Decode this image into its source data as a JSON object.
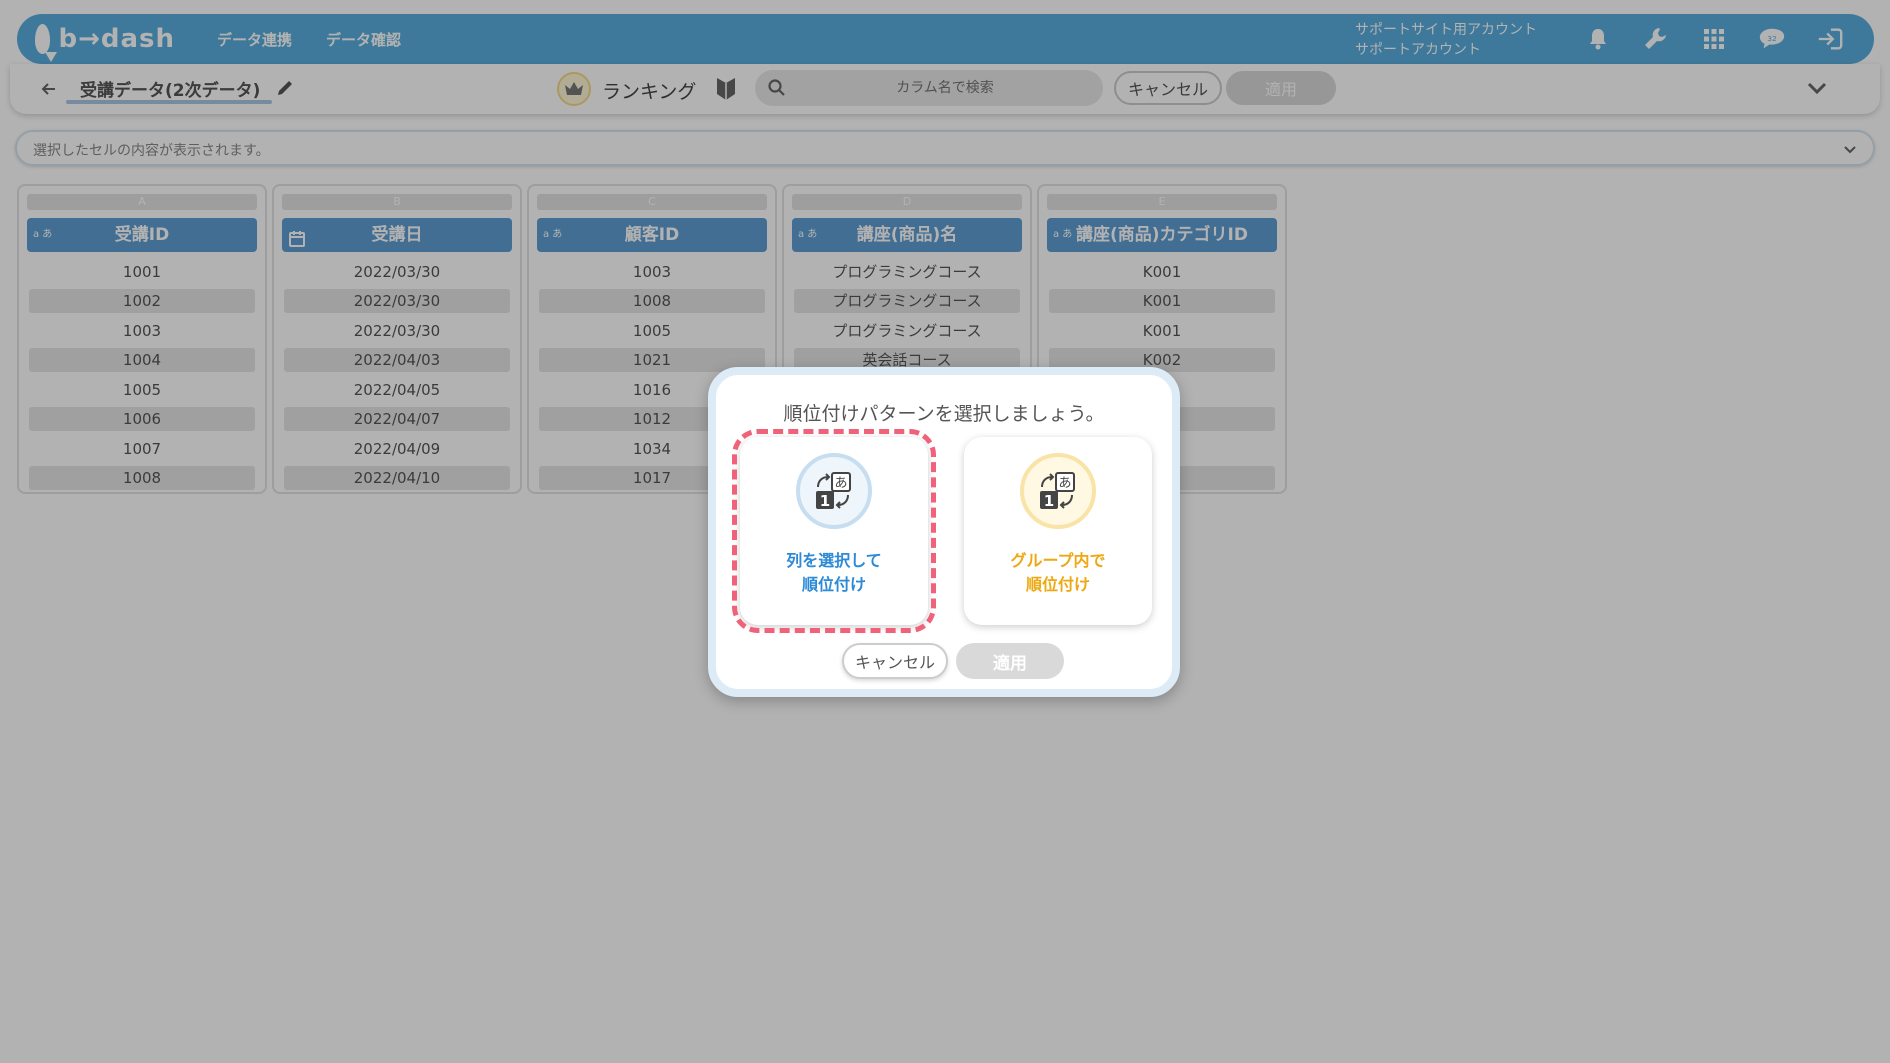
{
  "header": {
    "logo_text": "b→dash",
    "nav": [
      "データ連携",
      "データ確認"
    ],
    "account_line1": "サポートサイト用アカウント",
    "account_line2": "サポートアカウント",
    "icons": [
      "bell-icon",
      "wrench-icon",
      "grid-icon",
      "chat-icon",
      "logout-icon"
    ]
  },
  "toolbar": {
    "dataset_name": "受講データ(2次データ)",
    "mode": "ランキング",
    "search_placeholder": "カラム名で検索",
    "cancel_label": "キャンセル",
    "apply_label": "適用"
  },
  "cellbar": {
    "text": "選択したセルの内容が表示されます。"
  },
  "columns": [
    {
      "letter": "A",
      "type": "text",
      "name": "受講ID",
      "cells": [
        "1001",
        "1002",
        "1003",
        "1004",
        "1005",
        "1006",
        "1007",
        "1008"
      ]
    },
    {
      "letter": "B",
      "type": "date",
      "name": "受講日",
      "cells": [
        "2022/03/30",
        "2022/03/30",
        "2022/03/30",
        "2022/04/03",
        "2022/04/05",
        "2022/04/07",
        "2022/04/09",
        "2022/04/10"
      ]
    },
    {
      "letter": "C",
      "type": "text",
      "name": "顧客ID",
      "cells": [
        "1003",
        "1008",
        "1005",
        "1021",
        "1016",
        "1012",
        "1034",
        "1017"
      ]
    },
    {
      "letter": "D",
      "type": "text",
      "name": "講座(商品)名",
      "cells": [
        "プログラミングコース",
        "プログラミングコース",
        "プログラミングコース",
        "英会話コース",
        "",
        "",
        "",
        ""
      ]
    },
    {
      "letter": "E",
      "type": "text",
      "name": "講座(商品)カテゴリID",
      "cells": [
        "K001",
        "K001",
        "K001",
        "K002",
        "",
        "",
        "",
        ""
      ]
    }
  ],
  "text_type_label": "a あ",
  "modal": {
    "title": "順位付けパターンを選択しましょう。",
    "option1": {
      "line1": "列を選択して",
      "line2": "順位付け"
    },
    "option2": {
      "line1": "グループ内で",
      "line2": "順位付け"
    },
    "cancel_label": "キャンセル",
    "apply_label": "適用"
  },
  "colors": {
    "header_bg": "#5aaede",
    "column_header": "#5d9ed2",
    "highlight": "#f0627a",
    "option1_text": "#2c8ad6",
    "option2_text": "#eea812"
  }
}
